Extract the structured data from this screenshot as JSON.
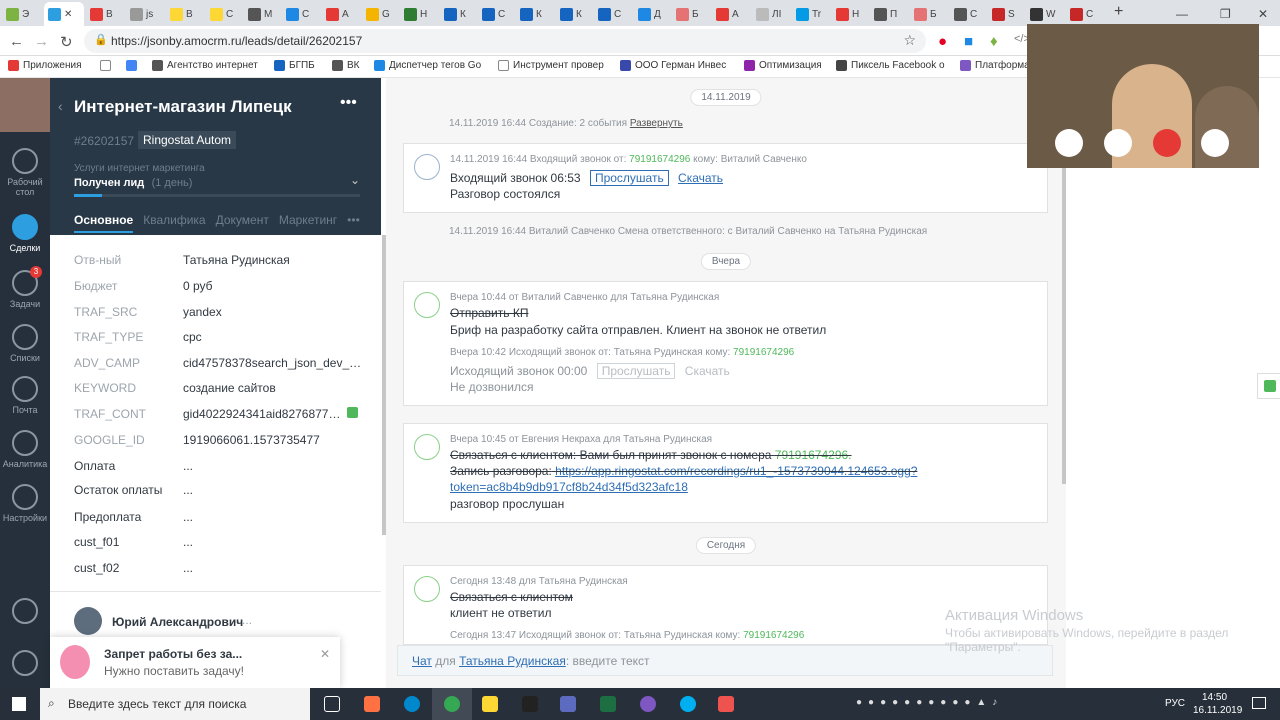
{
  "browser": {
    "tabs": [
      "Э",
      "В",
      "js",
      "В",
      "С",
      "М",
      "С",
      "А",
      "G",
      "Н",
      "К",
      "С",
      "К",
      "К",
      "С",
      "Д",
      "Б",
      "А",
      "ЛІ",
      "Tr",
      "Н",
      "П",
      "Б",
      "С",
      "S",
      "W",
      "С"
    ],
    "url": "https://jsonby.amocrm.ru/leads/detail/26202157",
    "bookmarks": [
      "Приложения",
      "",
      "Агентство интернет",
      "БГПБ",
      "ВК",
      "Диспетчер тегов Go",
      "Инструмент провер",
      "ООО Герман Инвес",
      "Оптимизация",
      "Пиксель Facebook о",
      "Платформа"
    ]
  },
  "leftnav": [
    {
      "label": "Рабочий стол",
      "icon": "dashboard-icon"
    },
    {
      "label": "Сделки",
      "icon": "deals-icon",
      "active": true
    },
    {
      "label": "Задачи",
      "icon": "tasks-icon",
      "badge": "3"
    },
    {
      "label": "Списки",
      "icon": "lists-icon"
    },
    {
      "label": "Почта",
      "icon": "mail-icon"
    },
    {
      "label": "Аналитика",
      "icon": "analytics-icon"
    },
    {
      "label": "Настройки",
      "icon": "settings-icon"
    }
  ],
  "lead": {
    "title": "Интернет-магазин Липецк",
    "id": "#26202157",
    "tag": "Ringostat Autom",
    "pipeline": "Услуги интернет маркетинга",
    "stage": "Получен лид",
    "stage_days": "(1 день)",
    "tabs": [
      "Основное",
      "Квалифика",
      "Документ",
      "Маркетинг"
    ]
  },
  "fields": [
    {
      "label": "Отв-ный",
      "value": "Татьяна Рудинская",
      "style": "dark"
    },
    {
      "label": "Бюджет",
      "value": "0 руб",
      "style": "dark"
    },
    {
      "label": "TRAF_SRC",
      "value": "yandex",
      "style": "grey"
    },
    {
      "label": "TRAF_TYPE",
      "value": "cpc",
      "style": "grey"
    },
    {
      "label": "ADV_CAMP",
      "value": "cid47578378search_json_dev_hi...",
      "style": "grey"
    },
    {
      "label": "KEYWORD",
      "value": "создание сайтов",
      "style": "grey"
    },
    {
      "label": "TRAF_CONT",
      "value": "gid4022924341aid8276877155",
      "style": "grey"
    },
    {
      "label": "GOOGLE_ID",
      "value": "1919066061.1573735477",
      "style": "grey"
    },
    {
      "label": "Оплата",
      "value": "...",
      "style": "dark"
    },
    {
      "label": "Остаток оплаты",
      "value": "...",
      "style": "dark"
    },
    {
      "label": "Предоплата",
      "value": "...",
      "style": "dark"
    },
    {
      "label": "cust_f01",
      "value": "...",
      "style": "dark"
    },
    {
      "label": "cust_f02",
      "value": "...",
      "style": "dark"
    }
  ],
  "contact": {
    "name": "Юрий Александрович",
    "more": "..."
  },
  "toast": {
    "title": "Запрет работы без за...",
    "text": "Нужно поставить задачу!"
  },
  "feed": {
    "day1": "14.11.2019",
    "created": "14.11.2019 16:44 Создание: 2 события",
    "expand": "Развернуть",
    "call1_meta_prefix": "14.11.2019 16:44 Входящий звонок от:",
    "call1_phone": "79191674296",
    "call1_meta_suffix": "кому: Виталий Савченко",
    "call1_line": "Входящий звонок 06:53",
    "listen": "Прослушать",
    "download": "Скачать",
    "call1_result": "Разговор состоялся",
    "resp_change": "14.11.2019 16:44 Виталий Савченко  Смена ответственного: с Виталий Савченко на Татьяна Рудинская",
    "day2": "Вчера",
    "task1_meta": "Вчера 10:44  от Виталий Савченко для Татьяна Рудинская",
    "task1_title": "Отправить КП",
    "task1_result": "Бриф на разработку сайта отправлен. Клиент на звонок не ответил",
    "call2_meta_prefix": "Вчера 10:42 Исходящий звонок от: Татьяна Рудинская кому:",
    "call2_phone": "79191674296",
    "call2_line": "Исходящий звонок 00:00",
    "call2_result": "Не дозвонился",
    "task2_meta": "Вчера 10:45  от Евгения Некраха для Татьяна Рудинская",
    "task2_title_prefix": "Связаться с клиентом: Вами был принят звонок с номера",
    "task2_phone": "79191674296.",
    "task2_rec_label": "Запись разговора:",
    "task2_rec_url1": "https://app.ringostat.com/recordings/ru1_-1573739044.124653.ogg?",
    "task2_rec_url2": "token=ac8b4b9db917cf8b24d34f5d323afc18",
    "task2_result": "разговор прослушан",
    "day3": "Сегодня",
    "task3_meta": "Сегодня 13:48  для Татьяна Рудинская",
    "task3_title": "Связаться с клиентом",
    "task3_result": "клиент не ответил",
    "call3_meta_prefix": "Сегодня 13:47 Исходящий звонок от: Татьяна Рудинская кому:",
    "call3_phone": "79191674296"
  },
  "chat": {
    "prefix": "Чат",
    "for": "для",
    "user": "Татьяна Рудинская",
    "placeholder": ": введите текст"
  },
  "watermark": {
    "title": "Активация Windows",
    "text1": "Чтобы активировать Windows, перейдите в раздел",
    "text2": "\"Параметры\"."
  },
  "taskbar": {
    "search": "Введите здесь текст для поиска",
    "lang": "РУС",
    "time": "14:50",
    "date": "16.11.2019"
  },
  "colors": {
    "sidebar": "#283847",
    "nav": "#25303c",
    "accent": "#2d9fe0",
    "phone": "#4fb85a"
  }
}
